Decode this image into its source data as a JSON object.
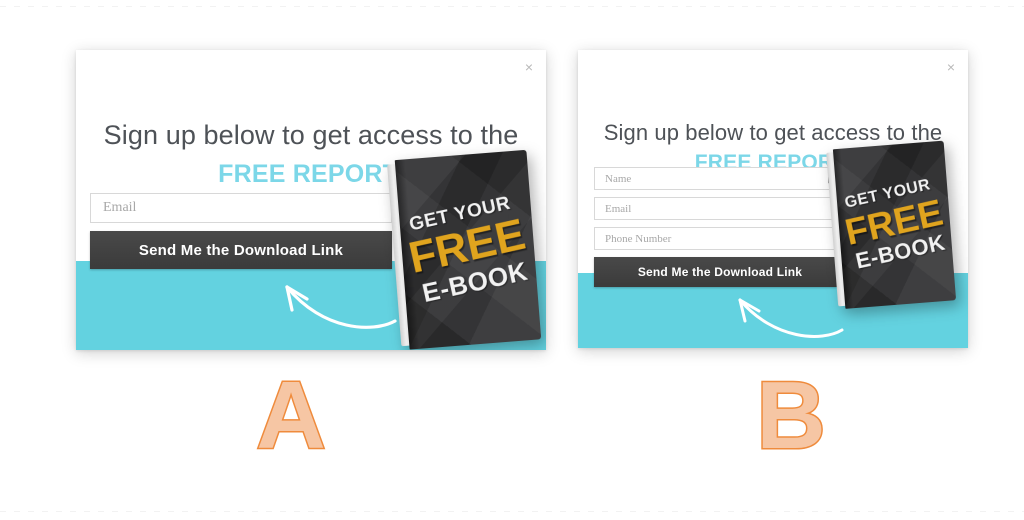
{
  "theme": {
    "teal": "#63d2e0",
    "accent_orange": "#ef8b3c",
    "letter_fill": "#f6c6a4",
    "headline_color": "#4e5257",
    "headline_accent_color": "#7cd7e8",
    "button_bg": "#3f3f3f",
    "ebook_cover": "#343436",
    "ebook_free_gold": "#e0a41e"
  },
  "ebook": {
    "line1": "GET YOUR",
    "line2": "FREE",
    "line3": "E-BOOK"
  },
  "variants": {
    "a": {
      "letter": "A",
      "close_label": "×",
      "headline": "Sign up below to get access to the",
      "headline_accent": "FREE REPORT:",
      "fields": [
        {
          "name": "email",
          "placeholder": "Email",
          "value": "",
          "badge": false
        }
      ],
      "cta_label": "Send Me the Download Link",
      "arrow": "curved-arrow-pointing-to-cta"
    },
    "b": {
      "letter": "B",
      "close_label": "×",
      "headline": "Sign up below to get access to the",
      "headline_accent": "FREE REPORT:",
      "fields": [
        {
          "name": "name",
          "placeholder": "Name",
          "value": "",
          "badge": true
        },
        {
          "name": "email",
          "placeholder": "Email",
          "value": "",
          "badge": false
        },
        {
          "name": "phone",
          "placeholder": "Phone Number",
          "value": "",
          "badge": false
        }
      ],
      "cta_label": "Send Me the Download Link",
      "arrow": "curved-arrow-pointing-to-cta"
    }
  }
}
